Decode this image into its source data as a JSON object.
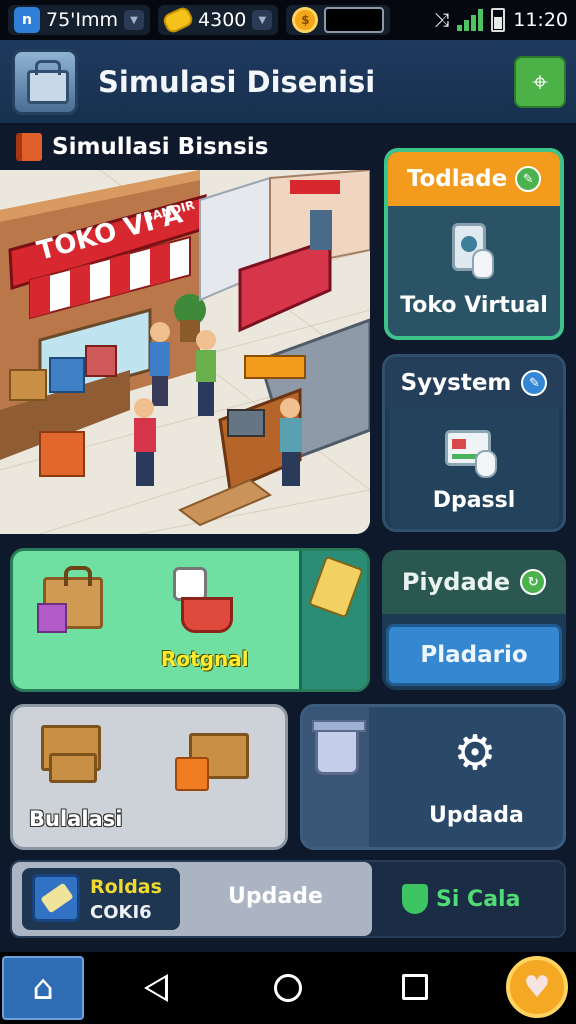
{
  "status_bar": {
    "left_text": "75'Imm",
    "coins": "4300",
    "time": "11:20",
    "gold_icon": "gold-coin-icon",
    "network_icon": "signal-icon"
  },
  "header": {
    "title": "Simulasi Disenisi"
  },
  "section": {
    "label": "Simullasi Bisnsis"
  },
  "scene": {
    "shop_sign": "TOKO VI A",
    "shop_sign_sub": "BANDIR"
  },
  "cards": {
    "toko": {
      "top_label": "Todlade",
      "label": "Toko Virtual"
    },
    "system": {
      "top_label": "Syystem",
      "label": "Dpassl"
    },
    "green": {
      "label": "Rotgnal"
    },
    "pay": {
      "top_label": "Piydade",
      "button": "Pladario"
    },
    "grey": {
      "label": "Bulalasi"
    },
    "update": {
      "label": "Updada"
    }
  },
  "bottom_bar": {
    "item_name": "Roldas",
    "item_code": "COKI6",
    "update_label": "Updade",
    "status_label": "Si Cala"
  },
  "colors": {
    "accent_green": "#3ec48a",
    "accent_orange": "#f39b1d",
    "accent_blue": "#3587cf",
    "background": "#0e1a2b"
  }
}
